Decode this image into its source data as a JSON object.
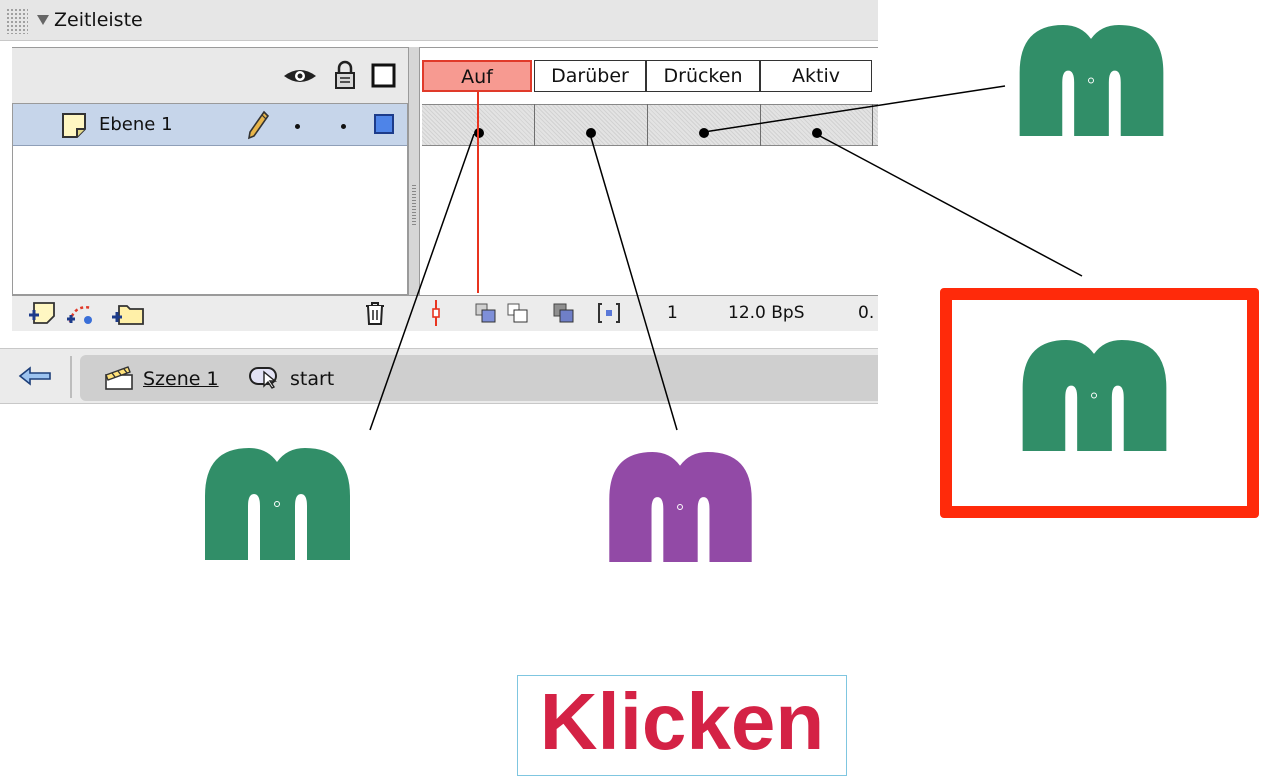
{
  "panel": {
    "title": "Zeitleiste",
    "layer_header_icons": [
      "eye-icon",
      "lock-icon",
      "outline-square-icon"
    ],
    "layer": {
      "name": "Ebene 1",
      "icons": [
        "layer-icon",
        "pencil-icon"
      ]
    },
    "frame_labels": [
      "Auf",
      "Darüber",
      "Drücken",
      "Aktiv"
    ],
    "status": {
      "frame": "1",
      "fps": "12.0 BpS",
      "time": "0."
    },
    "toolbar_icons": [
      "insert-layer-icon",
      "add-motion-guide-icon",
      "insert-folder-icon",
      "trash-icon",
      "center-frame-icon",
      "onion-skin-icon",
      "onion-skin-outlines-icon",
      "edit-multiple-frames-icon",
      "modify-onion-markers-icon"
    ]
  },
  "scene_bar": {
    "back_icon": "back-arrow-icon",
    "scene": "Szene 1",
    "symbol": "start"
  },
  "states": {
    "up_color": "#318e68",
    "over_color": "#924aa6",
    "down_color": "#318e68",
    "hit_color": "#318e68",
    "highlight_color": "#ff2a0a"
  },
  "click_text": "Klicken"
}
